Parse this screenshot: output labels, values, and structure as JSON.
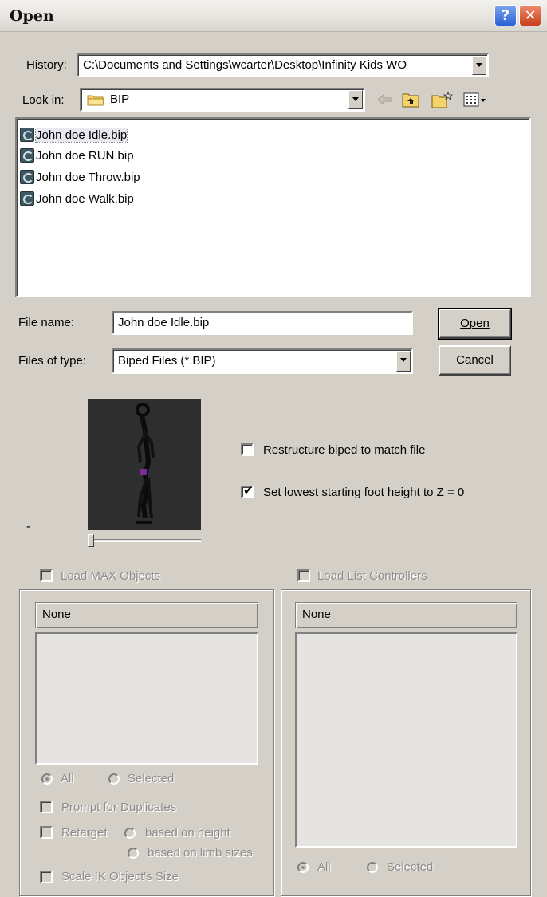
{
  "window": {
    "title": "Open",
    "help_label": "?",
    "close_label": "✕"
  },
  "history": {
    "label": "History:",
    "value": "C:\\Documents and Settings\\wcarter\\Desktop\\Infinity Kids WO"
  },
  "look_in": {
    "label": "Look in:",
    "value": "BIP",
    "icon": "folder-icon"
  },
  "toolbar": {
    "icons": [
      "back-arrow-icon",
      "up-folder-icon",
      "new-folder-icon",
      "view-menu-icon"
    ]
  },
  "files": [
    {
      "name": "John doe Idle.bip",
      "selected": true
    },
    {
      "name": "John doe RUN.bip",
      "selected": false
    },
    {
      "name": "John doe Throw.bip",
      "selected": false
    },
    {
      "name": "John doe Walk.bip",
      "selected": false
    }
  ],
  "file_name": {
    "label": "File name:",
    "value": "John doe Idle.bip"
  },
  "file_type": {
    "label": "Files of type:",
    "value": "Biped Files (*.BIP)"
  },
  "buttons": {
    "open": "Open",
    "cancel": "Cancel"
  },
  "preview": {
    "dash": "-",
    "slider_position": 0
  },
  "options": {
    "restructure": {
      "label": "Restructure biped to match file",
      "checked": false
    },
    "lowest_foot": {
      "label": "Set lowest starting foot height to Z = 0",
      "checked": true
    }
  },
  "max_objects": {
    "title": "Load MAX Objects",
    "header": "None",
    "all_label": "All",
    "selected_label": "Selected",
    "prompt_duplicates": "Prompt for Duplicates",
    "retarget": "Retarget",
    "based_on_height": "based on height",
    "based_on_limb": "based on limb sizes",
    "scale_ik": "Scale IK Object's Size"
  },
  "list_controllers": {
    "title": "Load List Controllers",
    "header": "None",
    "all_label": "All",
    "selected_label": "Selected"
  },
  "colors": {
    "dialog_bg": "#d4d0c8",
    "help_button": "#2a5fd6",
    "close_button": "#c8401d",
    "preview_bg": "#2e2e2e"
  }
}
